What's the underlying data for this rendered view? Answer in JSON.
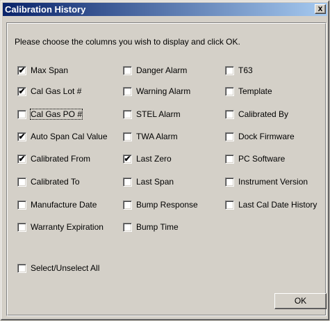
{
  "window": {
    "title": "Calibration History",
    "close_glyph": "x"
  },
  "instructions": "Please choose the columns you wish to display and click OK.",
  "columns": {
    "col1": [
      {
        "label": "Max Span",
        "checked": true
      },
      {
        "label": "Cal Gas Lot #",
        "checked": true
      },
      {
        "label": "Cal Gas PO #",
        "checked": false,
        "focused": true
      },
      {
        "label": "Auto Span Cal Value",
        "checked": true
      },
      {
        "label": "Calibrated From",
        "checked": true
      },
      {
        "label": "Calibrated To",
        "checked": false
      },
      {
        "label": "Manufacture Date",
        "checked": false
      },
      {
        "label": "Warranty Expiration",
        "checked": false
      }
    ],
    "col2": [
      {
        "label": "Danger Alarm",
        "checked": false
      },
      {
        "label": "Warning Alarm",
        "checked": false
      },
      {
        "label": "STEL Alarm",
        "checked": false
      },
      {
        "label": "TWA Alarm",
        "checked": false
      },
      {
        "label": "Last Zero",
        "checked": true
      },
      {
        "label": "Last Span",
        "checked": false
      },
      {
        "label": "Bump Response",
        "checked": false
      },
      {
        "label": "Bump Time",
        "checked": false
      }
    ],
    "col3": [
      {
        "label": "T63",
        "checked": false
      },
      {
        "label": "Template",
        "checked": false
      },
      {
        "label": "Calibrated By",
        "checked": false
      },
      {
        "label": "Dock Firmware",
        "checked": false
      },
      {
        "label": "PC Software",
        "checked": false
      },
      {
        "label": "Instrument Version",
        "checked": false
      },
      {
        "label": "Last Cal Date History",
        "checked": false
      }
    ]
  },
  "select_all": {
    "label": "Select/Unselect All",
    "checked": false
  },
  "ok_button": "OK",
  "check_glyph": "✔"
}
